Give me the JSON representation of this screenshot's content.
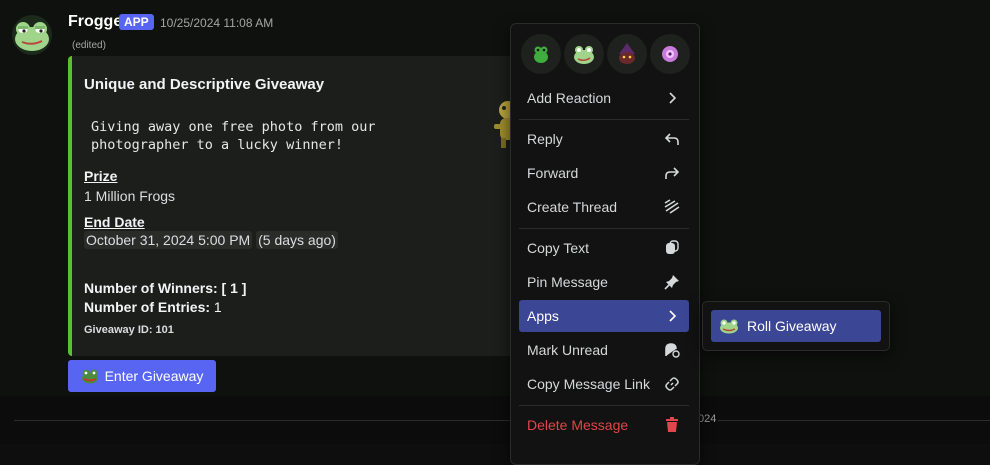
{
  "message": {
    "username": "Frogge",
    "badge": "APP",
    "timestamp": "10/25/2024 11:08 AM",
    "edited": "(edited)"
  },
  "embed": {
    "title": "Unique and Descriptive Giveaway",
    "description": "Giving away one free photo from our\nphotographer to a lucky winner!",
    "prize_label": "Prize",
    "prize_value": "1 Million Frogs",
    "end_label": "End Date",
    "end_date": "October 31, 2024 5:00 PM",
    "end_relative": "(5 days ago)",
    "winners_label": "Number of Winners:",
    "winners_value": "[ 1 ]",
    "entries_label": "Number of Entries:",
    "entries_value": "1",
    "giveaway_id": "Giveaway ID: 101",
    "accent_color": "#57c131"
  },
  "enter_button": {
    "label": "Enter Giveaway",
    "icon": "frog-icon"
  },
  "context_menu": {
    "reactions": [
      "frog-emoji",
      "frog-face-emoji",
      "wizard-frog-emoji",
      "pink-creature-emoji"
    ],
    "items": [
      {
        "label": "Add Reaction",
        "icon": "chevron-right-icon"
      },
      {
        "label": "Reply",
        "icon": "reply-icon"
      },
      {
        "label": "Forward",
        "icon": "forward-icon"
      },
      {
        "label": "Create Thread",
        "icon": "thread-icon"
      },
      {
        "label": "Copy Text",
        "icon": "copy-icon"
      },
      {
        "label": "Pin Message",
        "icon": "pin-icon"
      },
      {
        "label": "Apps",
        "icon": "chevron-right-icon"
      },
      {
        "label": "Mark Unread",
        "icon": "mark-unread-icon"
      },
      {
        "label": "Copy Message Link",
        "icon": "link-icon"
      },
      {
        "label": "Delete Message",
        "icon": "trash-icon"
      }
    ]
  },
  "apps_submenu": {
    "items": [
      {
        "label": "Roll Giveaway",
        "icon": "frog-icon"
      }
    ]
  },
  "divider": {
    "text": "024"
  },
  "colors": {
    "blurple": "#5865f2",
    "menu_active": "#3b4695",
    "danger": "#e0464b"
  }
}
